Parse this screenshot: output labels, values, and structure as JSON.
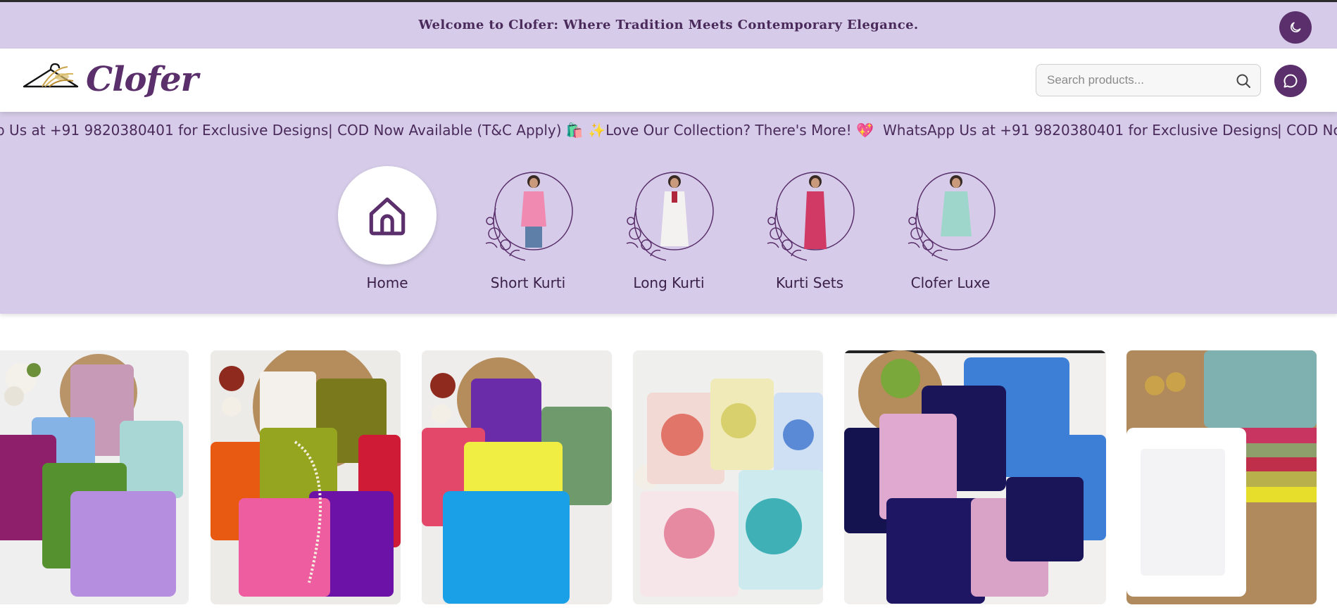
{
  "topbar": {
    "welcome": "Welcome to Clofer: Where Tradition Meets Contemporary Elegance.",
    "theme_icon": "moon-icon"
  },
  "header": {
    "brand": "Clofer",
    "logo_icon": "hanger-icon",
    "search": {
      "placeholder": "Search products...",
      "value": "",
      "icon": "search-icon"
    },
    "chat_icon": "chat-bubble-icon"
  },
  "ticker": {
    "items": [
      "p Us at +91 9820380401 for Exclusive Designs",
      "| COD Now Available (T&C Apply) 🛍️ ✨Love Our Collection? There's More! 💖",
      "WhatsApp Us at +91 9820380401 for Exclusive Designs",
      "| COD No"
    ]
  },
  "categories": [
    {
      "label": "Home",
      "icon": "home-icon"
    },
    {
      "label": "Short Kurti",
      "icon": "model-photo"
    },
    {
      "label": "Long Kurti",
      "icon": "model-photo"
    },
    {
      "label": "Kurti Sets",
      "icon": "model-photo"
    },
    {
      "label": "Clofer Luxe",
      "icon": "model-photo"
    }
  ],
  "products": [
    {
      "name": "product-image-1",
      "colors": [
        "#8e1f6b",
        "#86b3e6",
        "#c79ab8",
        "#56912f",
        "#a9d7d6",
        "#b58ee0"
      ]
    },
    {
      "name": "product-image-2",
      "colors": [
        "#e85a12",
        "#96a51f",
        "#ee5da0",
        "#7a7a1c",
        "#cf1b35",
        "#6d12a6"
      ]
    },
    {
      "name": "product-image-3",
      "colors": [
        "#e3476a",
        "#6a2ca8",
        "#6f9a6b",
        "#f0ee43",
        "#1aa0e6"
      ]
    },
    {
      "name": "product-image-4",
      "colors": [
        "#e27569",
        "#d8d06c",
        "#5a8ad6",
        "#e58aa0",
        "#3fb0b5"
      ]
    },
    {
      "name": "product-image-5",
      "colors": [
        "#14124f",
        "#e0a9cf",
        "#1a1458",
        "#3d7fd6",
        "#1e1563",
        "#d9a3c8"
      ]
    },
    {
      "name": "product-image-6",
      "colors": [
        "#7fb1b0",
        "#ffffff",
        "#c83560",
        "#b8b04a",
        "#e7dd2b"
      ]
    }
  ]
}
